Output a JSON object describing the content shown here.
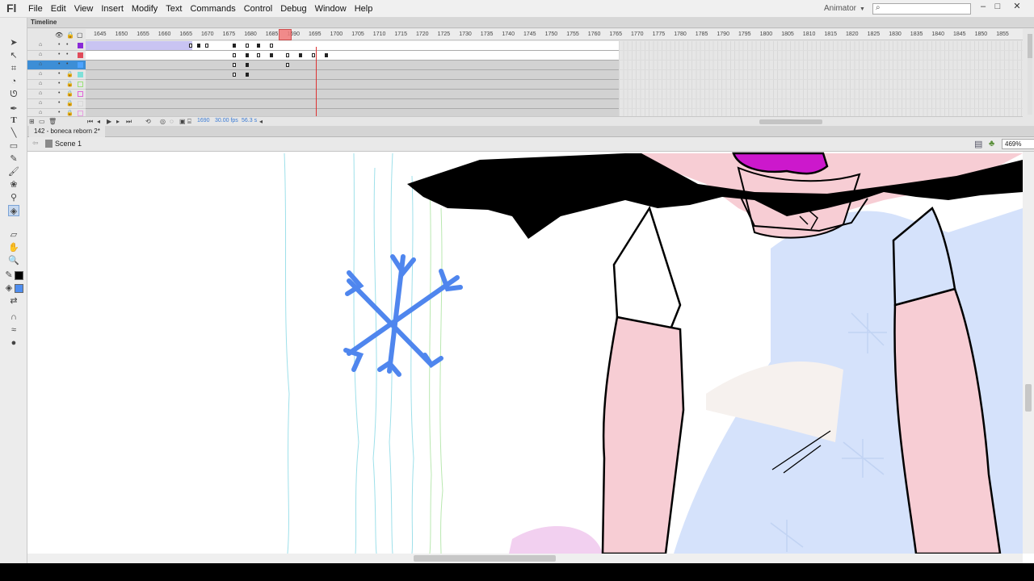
{
  "app": {
    "logo": "Fl",
    "workspace": "Animator",
    "search_placeholder": "",
    "win_minimize": "–",
    "win_restore": "□",
    "win_close": "✕"
  },
  "menu": [
    "File",
    "Edit",
    "View",
    "Insert",
    "Modify",
    "Text",
    "Commands",
    "Control",
    "Debug",
    "Window",
    "Help"
  ],
  "timeline": {
    "title": "Timeline",
    "ruler_labels": [
      "1645",
      "1650",
      "1655",
      "1660",
      "1665",
      "1670",
      "1675",
      "1680",
      "1685",
      "1690",
      "1695",
      "1700",
      "1705",
      "1710",
      "1715",
      "1720",
      "1725",
      "1730",
      "1735",
      "1740",
      "1745",
      "1750",
      "1755",
      "1760",
      "1765",
      "1770",
      "1775",
      "1780",
      "1785",
      "1790",
      "1795",
      "1800",
      "1805",
      "1810",
      "1815",
      "1820",
      "1825",
      "1830",
      "1835",
      "1840",
      "1845",
      "1850",
      "1855"
    ],
    "current_frame": "1690",
    "fps": "30.00 fps",
    "time": "56.3 s",
    "layers": [
      {
        "color": "#8a2ad8"
      },
      {
        "color": "#e04b5a"
      },
      {
        "color": "#4da3ff"
      },
      {
        "color": "#7fe0d8"
      },
      {
        "color": "#9be07a"
      },
      {
        "color": "#e066d8"
      },
      {
        "color": "#d8d8d8"
      },
      {
        "color": "#e6a0e0"
      }
    ]
  },
  "document": {
    "tab": "142 - boneca reborn 2*",
    "scene": "Scene 1",
    "zoom": "469%"
  },
  "colors": {
    "stroke": "#000000",
    "fill": "#4f8ef0"
  }
}
